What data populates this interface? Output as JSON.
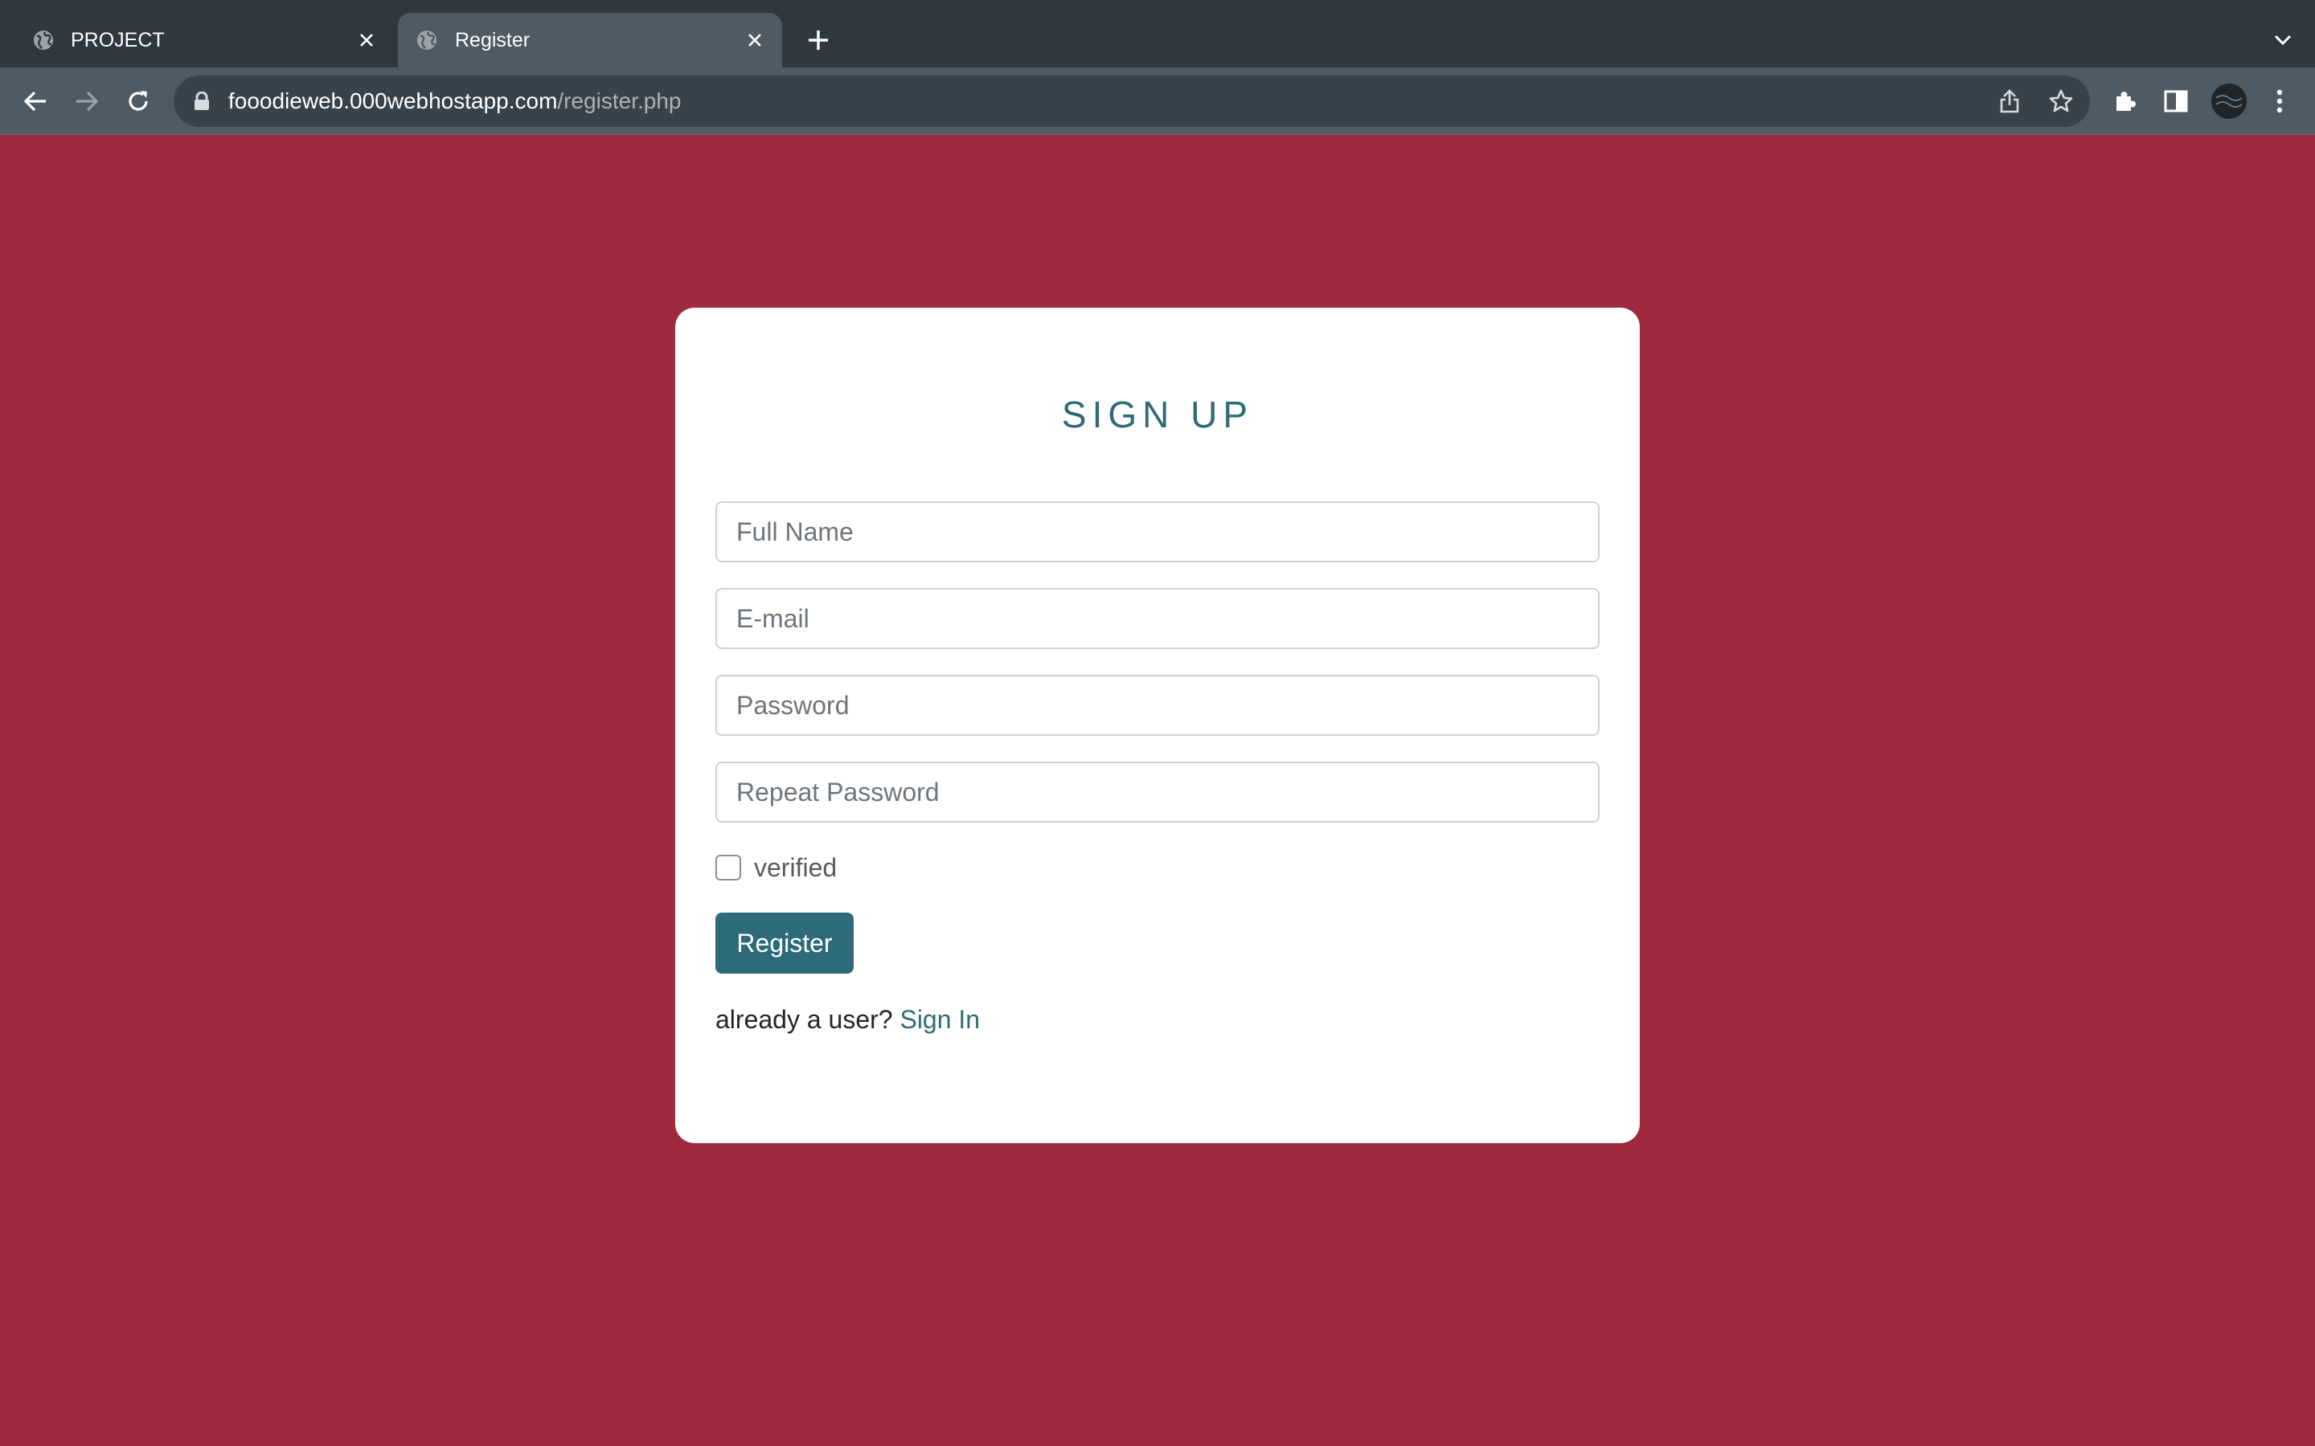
{
  "browser": {
    "tabs": [
      {
        "title": "PROJECT",
        "active": false
      },
      {
        "title": "Register",
        "active": true
      }
    ],
    "url_host": "fooodieweb.000webhostapp.com",
    "url_path": "/register.php"
  },
  "form": {
    "title": "SIGN UP",
    "full_name_placeholder": "Full Name",
    "email_placeholder": "E-mail",
    "password_placeholder": "Password",
    "repeat_password_placeholder": "Repeat Password",
    "verified_label": "verified",
    "verified_checked": false,
    "register_label": "Register",
    "already_user_text": "already a user?",
    "sign_in_label": "Sign In"
  },
  "colors": {
    "page_background": "#9f2a3d",
    "accent": "#2e6b79",
    "card_background": "#ffffff"
  },
  "icons": {
    "tab_favicon": "globe-icon",
    "tab_close": "close-icon",
    "new_tab": "plus-icon",
    "tab_list": "chevron-down-icon",
    "back": "arrow-left-icon",
    "forward": "arrow-right-icon",
    "reload": "reload-icon",
    "secure": "lock-icon",
    "share": "share-icon",
    "bookmark": "star-icon",
    "extensions": "puzzle-icon",
    "side_panel": "side-panel-icon",
    "profile": "avatar",
    "menu": "kebab-menu-icon"
  }
}
